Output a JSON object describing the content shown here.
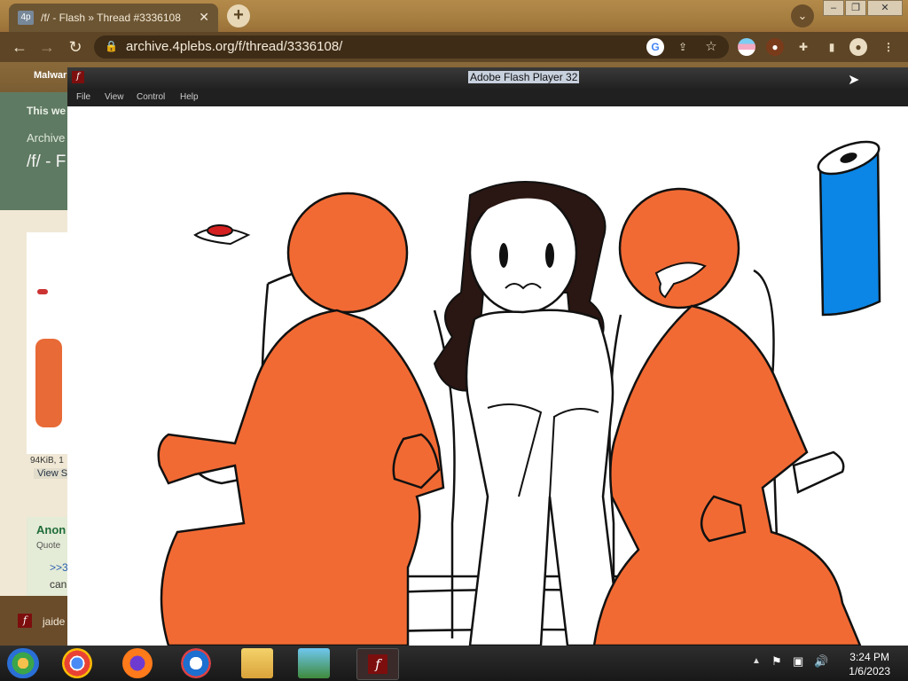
{
  "browser": {
    "tab_title": "/f/ - Flash » Thread #3336108",
    "tab_favicon": "4p",
    "url": "archive.4plebs.org/f/thread/3336108/",
    "bookmark_label": "Malwar"
  },
  "page_behind": {
    "line1": "This we",
    "line2": "Archive",
    "line3": "/f/ - F",
    "file_info": "94KiB, 1",
    "view_link": "View S",
    "poster": "Anon",
    "quoted": "Quote",
    "reply_link": ">>3",
    "reply_text": "can",
    "taskbar_item": "jaide"
  },
  "flash": {
    "title": "Adobe Flash Player 32",
    "menu": [
      "File",
      "View",
      "Control",
      "Help"
    ]
  },
  "taskbar": {
    "time": "3:24 PM",
    "date": "1/6/2023"
  },
  "colors": {
    "orange": "#f26a33",
    "blue": "#0b86e6",
    "hair": "#2a1612",
    "button_red": "#d42020"
  }
}
